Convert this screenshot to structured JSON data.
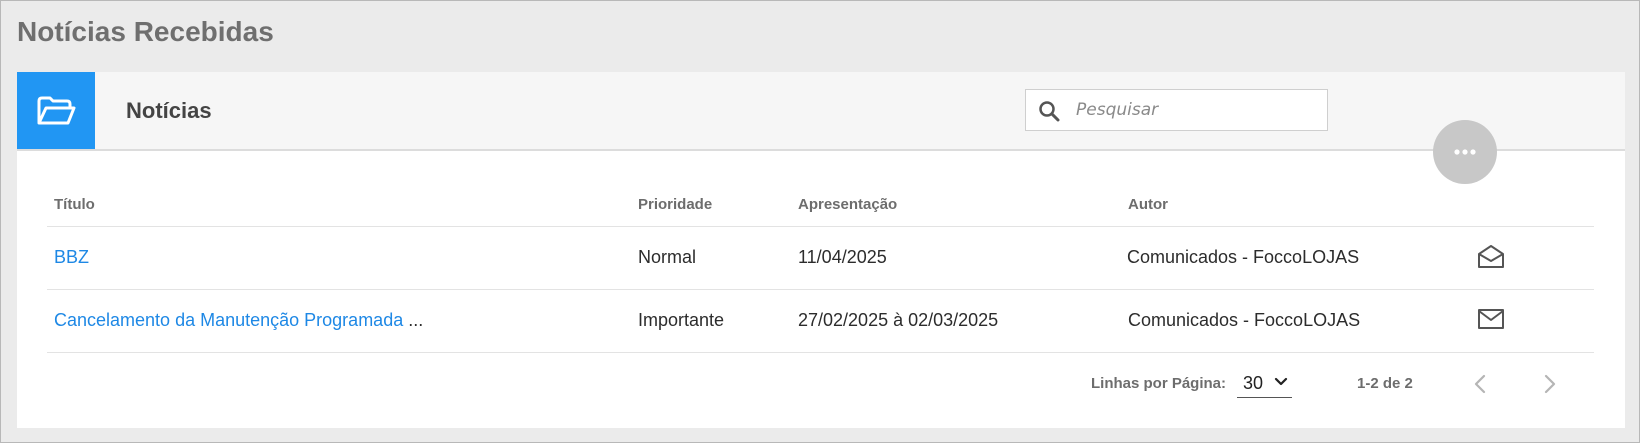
{
  "page": {
    "title": "Notícias Recebidas"
  },
  "panel": {
    "title": "Notícias",
    "icon": "folder-open-icon",
    "accent_color": "#2196f3"
  },
  "search": {
    "placeholder": "Pesquisar",
    "value": "",
    "icon": "search-icon"
  },
  "more_button": {
    "icon": "more-horizontal-icon"
  },
  "table": {
    "columns": {
      "title": "Título",
      "priority": "Prioridade",
      "presentation": "Apresentação",
      "author": "Autor"
    },
    "rows": [
      {
        "title": "BBZ",
        "title_suffix": "",
        "priority": "Normal",
        "presentation": "11/04/2025",
        "author": "Comunicados - FoccoLOJAS",
        "status_icon": "mail-open-icon"
      },
      {
        "title": "Cancelamento da Manutenção Programada",
        "title_suffix": "...",
        "priority": "Importante",
        "presentation": "27/02/2025 à 02/03/2025",
        "author": "Comunicados - FoccoLOJAS",
        "status_icon": "mail-closed-icon"
      }
    ]
  },
  "pagination": {
    "rows_per_page_label": "Linhas por Página:",
    "rows_per_page": "30",
    "range": "1-2 de 2"
  },
  "colors": {
    "link": "#1e88e5",
    "more_button": "#c8c8c8"
  }
}
